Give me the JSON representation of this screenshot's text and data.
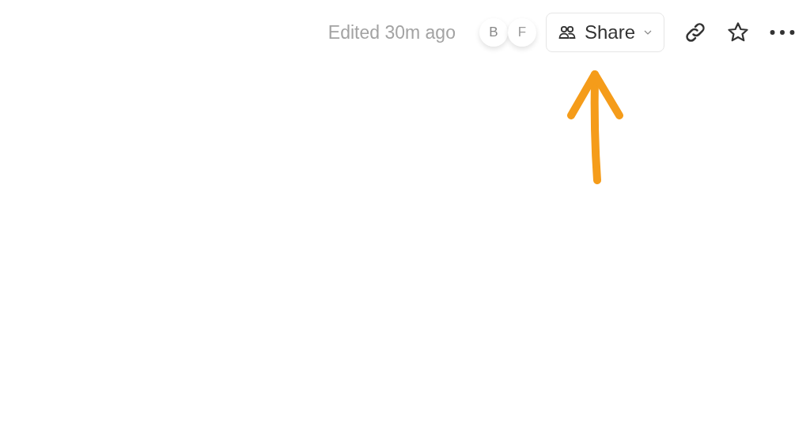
{
  "topbar": {
    "edited": "Edited 30m ago",
    "avatars": [
      "B",
      "F"
    ],
    "share_button": {
      "label": "Share"
    }
  }
}
